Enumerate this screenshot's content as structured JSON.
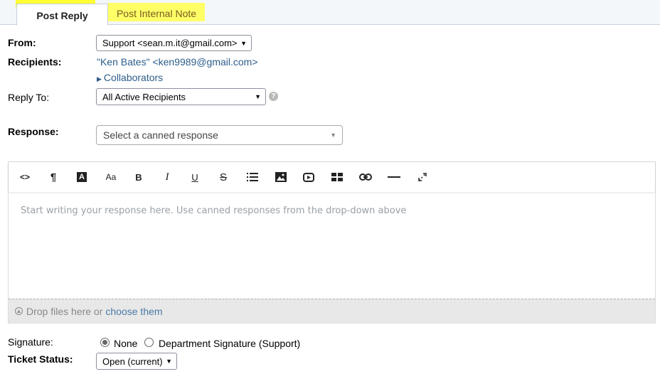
{
  "tabs": {
    "post_reply": "Post Reply",
    "post_internal_note": "Post Internal Note"
  },
  "form": {
    "from_label": "From:",
    "from_value": "Support <sean.m.it@gmail.com>",
    "recipients_label": "Recipients:",
    "recipient": "\"Ken Bates\" <ken9989@gmail.com>",
    "collaborators": "Collaborators",
    "reply_to_label": "Reply To:",
    "reply_to_value": "All Active Recipients",
    "response_label": "Response:",
    "canned_placeholder": "Select a canned response",
    "editor_placeholder": "Start writing your response here. Use canned responses from the drop-down above",
    "drop_text": "Drop files here or",
    "choose_text": "choose them",
    "signature_label": "Signature:",
    "signature_options": [
      "None",
      "Department Signature (Support)"
    ],
    "ticket_status_label": "Ticket Status:",
    "ticket_status_value": "Open (current)"
  },
  "toolbar_icons": [
    "code-view-icon",
    "paragraph-icon",
    "text-color-icon",
    "font-size-icon",
    "bold-icon",
    "italic-icon",
    "underline-icon",
    "strikethrough-icon",
    "list-icon",
    "image-icon",
    "video-icon",
    "table-icon",
    "link-icon",
    "horizontal-rule-icon",
    "fullscreen-icon"
  ],
  "colors": {
    "highlight": "#ffff33",
    "link": "#2c5d8a"
  }
}
